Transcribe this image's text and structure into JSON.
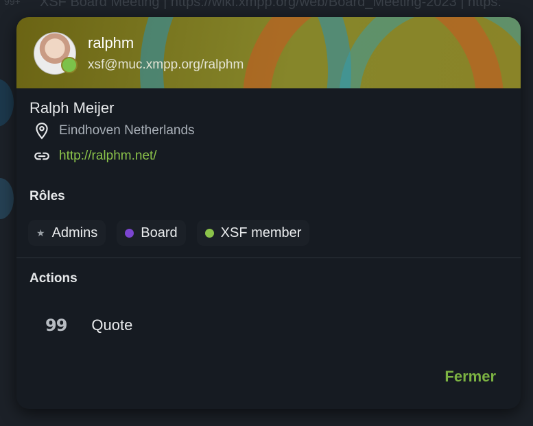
{
  "background": {
    "badge": "99+",
    "header_text": "XSF Board Meeting | https://wiki.xmpp.org/web/Board_Meeting-2023 | https:"
  },
  "profile": {
    "nickname": "ralphm",
    "jid": "xsf@muc.xmpp.org/ralphm",
    "full_name": "Ralph Meijer",
    "location": "Eindhoven Netherlands",
    "url": "http://ralphm.net/",
    "presence_color": "#7cc24a"
  },
  "roles": {
    "title": "Rôles",
    "items": [
      {
        "label": "Admins",
        "icon": "star-icon",
        "color": "#9aa0a6"
      },
      {
        "label": "Board",
        "icon": "dot",
        "color": "#7b45d0"
      },
      {
        "label": "XSF member",
        "icon": "dot",
        "color": "#8bc34a"
      }
    ]
  },
  "actions": {
    "title": "Actions",
    "quote_label": "Quote",
    "quote_icon": "99"
  },
  "close_label": "Fermer"
}
